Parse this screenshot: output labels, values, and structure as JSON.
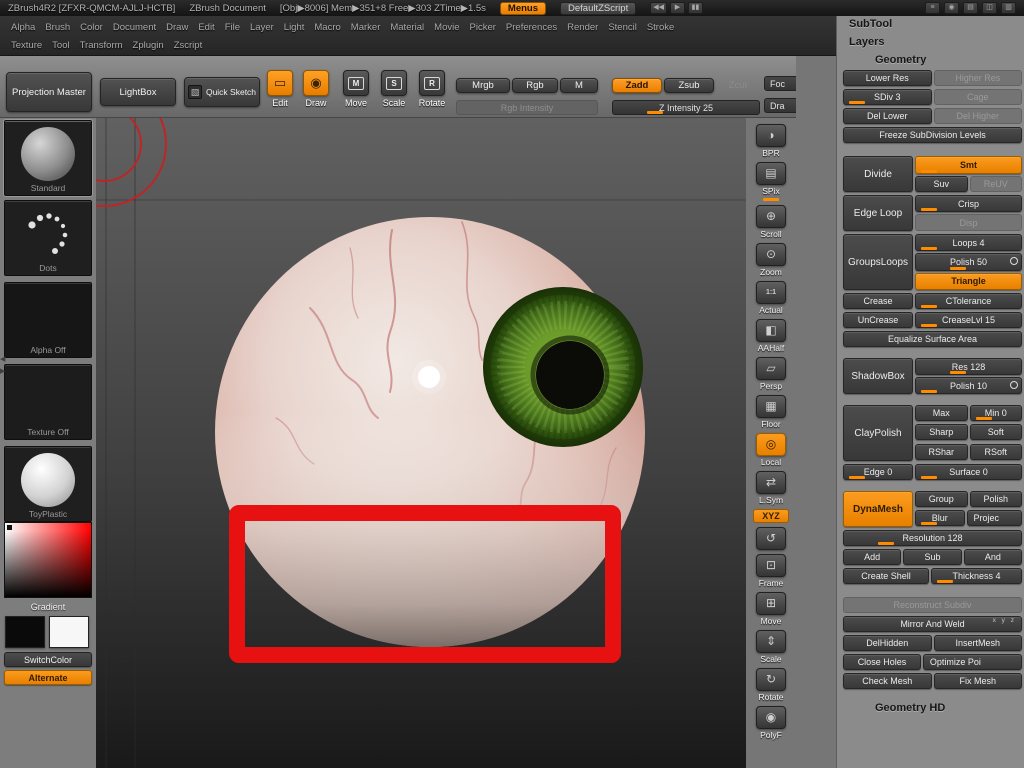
{
  "titlebar": {
    "app_title": "ZBrush4R2  [ZFXR-QMCM-AJLJ-HCTB]",
    "doc_title": "ZBrush Document",
    "stats": "[Obj▶8006]  Mem▶351+8  Free▶303  ZTime▶1.5s",
    "menus_button": "Menus",
    "zscript_button": "DefaultZScript"
  },
  "menubar": {
    "row1": [
      "Alpha",
      "Brush",
      "Color",
      "Document",
      "Draw",
      "Edit",
      "File",
      "Layer",
      "Light",
      "Macro",
      "Marker",
      "Material",
      "Movie",
      "Picker",
      "Preferences",
      "Render",
      "Stencil",
      "Stroke"
    ],
    "row2": [
      "Texture",
      "Tool",
      "Transform",
      "Zplugin",
      "Zscript"
    ]
  },
  "shelf": {
    "projection_master": "Projection Master",
    "lightbox": "LightBox",
    "quick_sketch": "Quick Sketch",
    "edit": "Edit",
    "draw": "Draw",
    "move": "Move",
    "scale": "Scale",
    "rotate": "Rotate",
    "mrgb": "Mrgb",
    "rgb": "Rgb",
    "m": "M",
    "rgb_intensity": "Rgb Intensity",
    "zadd": "Zadd",
    "zsub": "Zsub",
    "zcut": "Zcut",
    "z_intensity": "Z Intensity 25",
    "focal": "Foc",
    "draw_size": "Dra"
  },
  "left_tray": {
    "standard": "Standard",
    "dots": "Dots",
    "alpha_off": "Alpha Off",
    "texture_off": "Texture Off",
    "toyplastic": "ToyPlastic",
    "gradient": "Gradient",
    "switch_color": "SwitchColor",
    "alternate": "Alternate"
  },
  "canvas_strip": [
    "BPR",
    "SPix",
    "Scroll",
    "Zoom",
    "Actual",
    "AAHalf",
    "Persp",
    "Floor",
    "Local",
    "L.Sym",
    "XYZ",
    "Frame",
    "Move",
    "Scale",
    "Rotate",
    "PolyF"
  ],
  "tool_panel": {
    "subtool": "SubTool",
    "layers": "Layers",
    "geometry": "Geometry",
    "lower_res": "Lower Res",
    "higher_res": "Higher Res",
    "sdiv": "SDiv 3",
    "cage": "Cage",
    "del_lower": "Del Lower",
    "del_higher": "Del Higher",
    "freeze": "Freeze SubDivision Levels",
    "divide": "Divide",
    "smt": "Smt",
    "suv": "Suv",
    "reuv": "ReUV",
    "edge_loop": "Edge Loop",
    "crisp": "Crisp",
    "disp": "Disp",
    "groupsloops": "GroupsLoops",
    "loops": "Loops 4",
    "polish": "Polish 50",
    "triangle": "Triangle",
    "crease": "Crease",
    "ctolerance": "CTolerance",
    "uncrease": "UnCrease",
    "creaselvl": "CreaseLvl 15",
    "equalize": "Equalize Surface Area",
    "shadowbox": "ShadowBox",
    "res": "Res 128",
    "polish2": "Polish 10",
    "claypolish": "ClayPolish",
    "max": "Max",
    "min": "Min 0",
    "sharp": "Sharp",
    "soft": "Soft",
    "rshar": "RShar",
    "rsoft": "RSoft",
    "edge0": "Edge 0",
    "surface0": "Surface 0",
    "dynamesh": "DynaMesh",
    "group": "Group",
    "polish3": "Polish",
    "blur": "Blur",
    "project": "Projec",
    "resolution": "Resolution 128",
    "add": "Add",
    "sub": "Sub",
    "and": "And",
    "create_shell": "Create Shell",
    "thickness": "Thickness 4",
    "reconstruct": "Reconstruct Subdiv",
    "mirror_weld": "Mirror And Weld",
    "axes": "x y z",
    "delhidden": "DelHidden",
    "insertmesh": "InsertMesh",
    "close_holes": "Close Holes",
    "optimize": "Optimize Poi",
    "check_mesh": "Check Mesh",
    "fix_mesh": "Fix Mesh",
    "geometry_hd": "Geometry HD"
  },
  "icons": {
    "bpr": "◑",
    "spix": "▤",
    "scroll": "⊕",
    "zoom": "⊙",
    "actual": "1:1",
    "aahalf": "◧",
    "persp": "▱",
    "floor": "▦",
    "local": "◎",
    "lsym": "⇄",
    "spin": "↺",
    "frame": "⊡",
    "move": "⊞",
    "scale": "⇕",
    "rotate": "↻",
    "polyf": "◉",
    "quick_sketch": "▧",
    "edit": "▭",
    "draw": "◉",
    "move_letter": "M",
    "scale_letter": "S",
    "rotate_letter": "R",
    "rewind": "◀◀",
    "play": "▶",
    "pause": "▮▮",
    "sliders": "≡",
    "record": "◉",
    "grid": "▤",
    "columns": "◫",
    "rows": "▥",
    "tray_left": "◀",
    "tray_right": "▶"
  },
  "colors": {
    "accent_orange": "#f28a00",
    "overlay_red": "#e81111",
    "iris_green": "#6b9c2a",
    "canvas_top": "#616161",
    "canvas_bottom": "#191919"
  }
}
